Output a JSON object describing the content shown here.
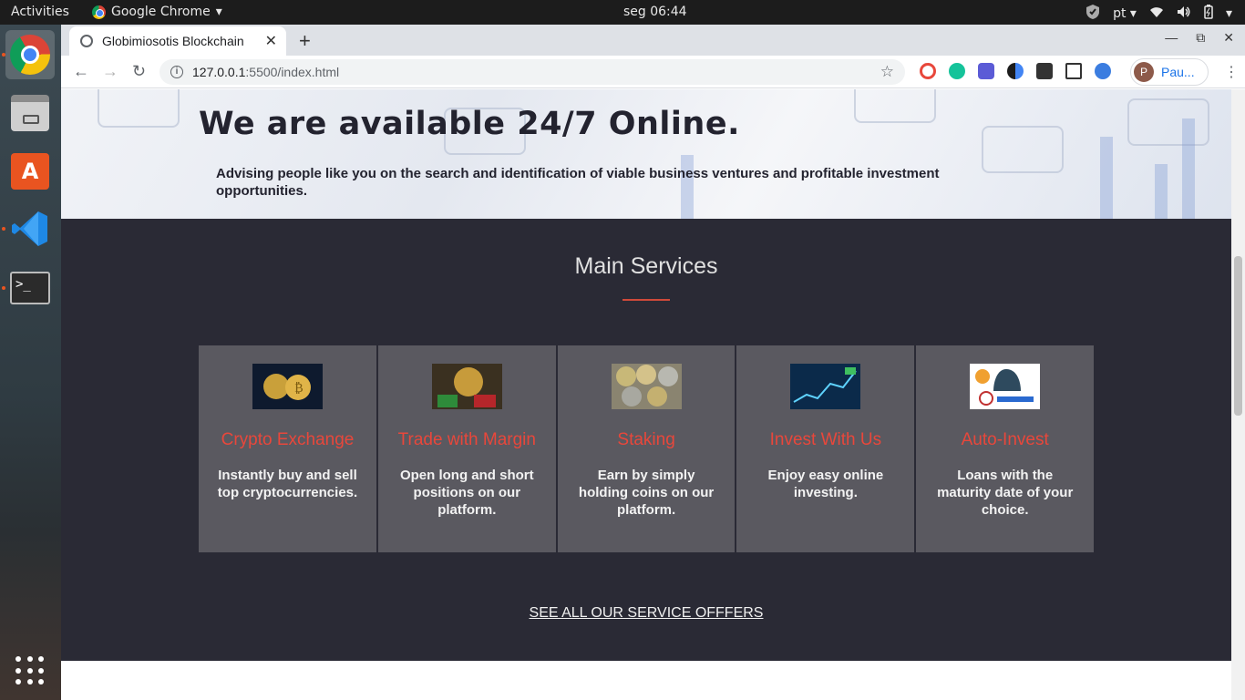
{
  "topbar": {
    "activities": "Activities",
    "app_name": "Google Chrome",
    "clock": "seg 06:44",
    "lang": "pt"
  },
  "dock": {
    "items": [
      "chrome",
      "files",
      "software-center",
      "vscode",
      "terminal"
    ],
    "terminal_glyph": ">_"
  },
  "browser": {
    "tab_title": "Globimiosotis Blockchain",
    "url_host": "127.0.0.1",
    "url_path": ":5500/index.html",
    "profile_initial": "P",
    "profile_name": "Pau..."
  },
  "hero": {
    "heading": "We are available 24/7 Online.",
    "subtext": "Advising people like you on the search and identification of viable business ventures and profitable investment opportunities."
  },
  "services": {
    "title": "Main Services",
    "accent": "#e8473b",
    "cards": [
      {
        "title": "Crypto Exchange",
        "desc": "Instantly buy and sell top cryptocurrencies."
      },
      {
        "title": "Trade with Margin",
        "desc": "Open long and short positions on our platform."
      },
      {
        "title": "Staking",
        "desc": "Earn by simply holding coins on our platform."
      },
      {
        "title": "Invest With Us",
        "desc": "Enjoy easy online investing."
      },
      {
        "title": "Auto-Invest",
        "desc": "Loans with the maturity date of your choice."
      }
    ],
    "see_all": "SEE ALL OUR SERVICE OFFFERS"
  }
}
